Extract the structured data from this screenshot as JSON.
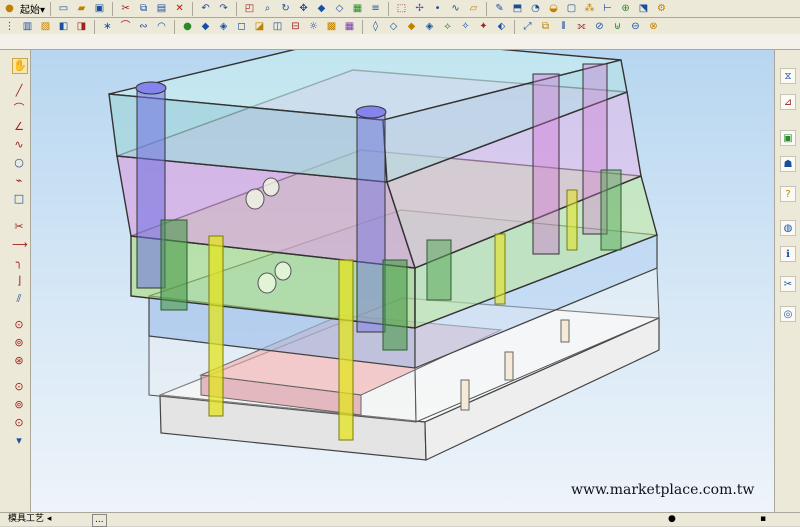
{
  "menu": {
    "start_label": "起始",
    "start_arrow": "▾"
  },
  "status": {
    "task_tab_label": "模具工艺",
    "task_tab_arrow": "◂",
    "more_label": "..."
  },
  "watermark": "www.marketplace.com.tw",
  "colors": {
    "viewport_top": "#b7d6f0",
    "viewport_bottom": "#eef4fa",
    "top_plate": "#9fd6d8",
    "plate_pink": "#e6a6e6",
    "plate_green": "#b6e68a",
    "plate_blue": "#a8c8f0",
    "base_plate": "#f2f2f2",
    "pin_yellow": "#e4e41e",
    "pin_green": "#4a9a4a",
    "pin_purple": "#7070e0"
  },
  "icons": {
    "toolbar": [
      "cursor-icon",
      "new-file-icon",
      "open-folder-icon",
      "save-icon",
      "cut-icon",
      "copy-icon",
      "paste-icon",
      "delete-icon",
      "undo-icon",
      "redo-icon",
      "zoom-icon",
      "rotate-icon",
      "pan-icon",
      "fit-icon",
      "shaded-icon",
      "wireframe-icon"
    ],
    "left": [
      "select-icon",
      "line-icon",
      "arc-icon",
      "circle-icon",
      "rectangle-icon",
      "spline-icon",
      "trim-icon",
      "extend-icon",
      "fillet-icon",
      "chamfer-icon",
      "offset-icon",
      "mirror-icon",
      "dimension-icon",
      "constraint-icon",
      "hole-icon"
    ],
    "right": [
      "history-icon",
      "part-navigator-icon",
      "assembly-icon",
      "role-icon",
      "help-icon",
      "web-icon",
      "info-icon",
      "tools-icon",
      "process-icon"
    ]
  }
}
